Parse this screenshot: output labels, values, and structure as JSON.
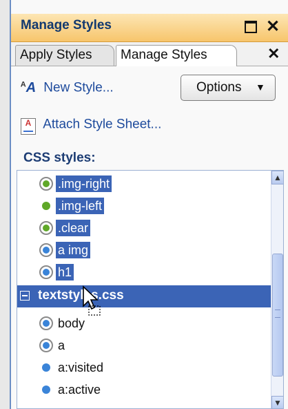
{
  "window": {
    "title": "Manage Styles"
  },
  "tabs": [
    {
      "label": "Apply Styles",
      "active": false
    },
    {
      "label": "Manage Styles",
      "active": true
    }
  ],
  "actions": {
    "new_style": "New Style...",
    "attach_sheet": "Attach Style Sheet...",
    "options": "Options"
  },
  "section_label": "CSS styles:",
  "styles": {
    "items_top": [
      {
        "label": ".img-right",
        "bullet": "green-ring",
        "selected": true
      },
      {
        "label": ".img-left",
        "bullet": "green-dot",
        "selected": true
      },
      {
        "label": ".clear",
        "bullet": "green-ring",
        "selected": true
      },
      {
        "label": "a img",
        "bullet": "blue-ring",
        "selected": true
      },
      {
        "label": "h1",
        "bullet": "blue-ring",
        "selected": true
      }
    ],
    "group": {
      "label": "textstyles.css",
      "expanded": true
    },
    "items_bottom": [
      {
        "label": "body",
        "bullet": "blue-ring",
        "selected": false
      },
      {
        "label": "a",
        "bullet": "blue-ring",
        "selected": false
      },
      {
        "label": "a:visited",
        "bullet": "blue-dot",
        "selected": false
      },
      {
        "label": "a:active",
        "bullet": "blue-dot",
        "selected": false
      }
    ]
  },
  "colors": {
    "titlebar": "#f7c56c",
    "selection": "#3b64b6",
    "green_bullet": "#5fa828",
    "blue_bullet": "#3a84d8"
  }
}
